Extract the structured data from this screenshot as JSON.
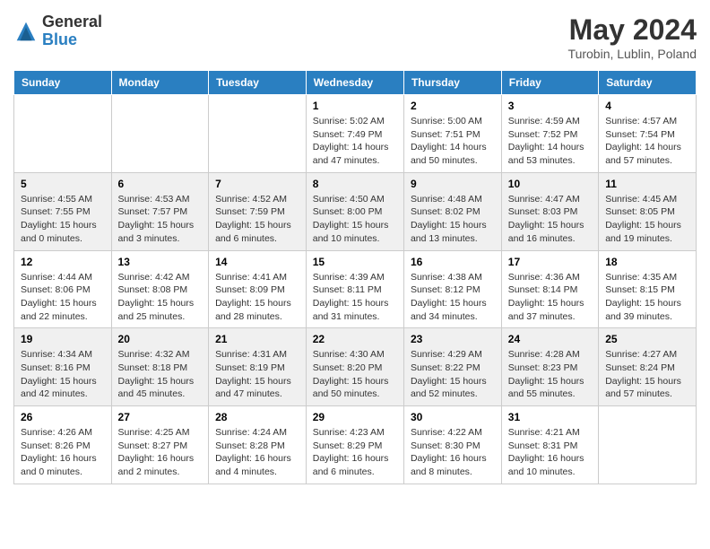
{
  "header": {
    "logo_general": "General",
    "logo_blue": "Blue",
    "month_title": "May 2024",
    "location": "Turobin, Lublin, Poland"
  },
  "columns": [
    "Sunday",
    "Monday",
    "Tuesday",
    "Wednesday",
    "Thursday",
    "Friday",
    "Saturday"
  ],
  "weeks": [
    [
      {
        "day": "",
        "info": ""
      },
      {
        "day": "",
        "info": ""
      },
      {
        "day": "",
        "info": ""
      },
      {
        "day": "1",
        "info": "Sunrise: 5:02 AM\nSunset: 7:49 PM\nDaylight: 14 hours\nand 47 minutes."
      },
      {
        "day": "2",
        "info": "Sunrise: 5:00 AM\nSunset: 7:51 PM\nDaylight: 14 hours\nand 50 minutes."
      },
      {
        "day": "3",
        "info": "Sunrise: 4:59 AM\nSunset: 7:52 PM\nDaylight: 14 hours\nand 53 minutes."
      },
      {
        "day": "4",
        "info": "Sunrise: 4:57 AM\nSunset: 7:54 PM\nDaylight: 14 hours\nand 57 minutes."
      }
    ],
    [
      {
        "day": "5",
        "info": "Sunrise: 4:55 AM\nSunset: 7:55 PM\nDaylight: 15 hours\nand 0 minutes."
      },
      {
        "day": "6",
        "info": "Sunrise: 4:53 AM\nSunset: 7:57 PM\nDaylight: 15 hours\nand 3 minutes."
      },
      {
        "day": "7",
        "info": "Sunrise: 4:52 AM\nSunset: 7:59 PM\nDaylight: 15 hours\nand 6 minutes."
      },
      {
        "day": "8",
        "info": "Sunrise: 4:50 AM\nSunset: 8:00 PM\nDaylight: 15 hours\nand 10 minutes."
      },
      {
        "day": "9",
        "info": "Sunrise: 4:48 AM\nSunset: 8:02 PM\nDaylight: 15 hours\nand 13 minutes."
      },
      {
        "day": "10",
        "info": "Sunrise: 4:47 AM\nSunset: 8:03 PM\nDaylight: 15 hours\nand 16 minutes."
      },
      {
        "day": "11",
        "info": "Sunrise: 4:45 AM\nSunset: 8:05 PM\nDaylight: 15 hours\nand 19 minutes."
      }
    ],
    [
      {
        "day": "12",
        "info": "Sunrise: 4:44 AM\nSunset: 8:06 PM\nDaylight: 15 hours\nand 22 minutes."
      },
      {
        "day": "13",
        "info": "Sunrise: 4:42 AM\nSunset: 8:08 PM\nDaylight: 15 hours\nand 25 minutes."
      },
      {
        "day": "14",
        "info": "Sunrise: 4:41 AM\nSunset: 8:09 PM\nDaylight: 15 hours\nand 28 minutes."
      },
      {
        "day": "15",
        "info": "Sunrise: 4:39 AM\nSunset: 8:11 PM\nDaylight: 15 hours\nand 31 minutes."
      },
      {
        "day": "16",
        "info": "Sunrise: 4:38 AM\nSunset: 8:12 PM\nDaylight: 15 hours\nand 34 minutes."
      },
      {
        "day": "17",
        "info": "Sunrise: 4:36 AM\nSunset: 8:14 PM\nDaylight: 15 hours\nand 37 minutes."
      },
      {
        "day": "18",
        "info": "Sunrise: 4:35 AM\nSunset: 8:15 PM\nDaylight: 15 hours\nand 39 minutes."
      }
    ],
    [
      {
        "day": "19",
        "info": "Sunrise: 4:34 AM\nSunset: 8:16 PM\nDaylight: 15 hours\nand 42 minutes."
      },
      {
        "day": "20",
        "info": "Sunrise: 4:32 AM\nSunset: 8:18 PM\nDaylight: 15 hours\nand 45 minutes."
      },
      {
        "day": "21",
        "info": "Sunrise: 4:31 AM\nSunset: 8:19 PM\nDaylight: 15 hours\nand 47 minutes."
      },
      {
        "day": "22",
        "info": "Sunrise: 4:30 AM\nSunset: 8:20 PM\nDaylight: 15 hours\nand 50 minutes."
      },
      {
        "day": "23",
        "info": "Sunrise: 4:29 AM\nSunset: 8:22 PM\nDaylight: 15 hours\nand 52 minutes."
      },
      {
        "day": "24",
        "info": "Sunrise: 4:28 AM\nSunset: 8:23 PM\nDaylight: 15 hours\nand 55 minutes."
      },
      {
        "day": "25",
        "info": "Sunrise: 4:27 AM\nSunset: 8:24 PM\nDaylight: 15 hours\nand 57 minutes."
      }
    ],
    [
      {
        "day": "26",
        "info": "Sunrise: 4:26 AM\nSunset: 8:26 PM\nDaylight: 16 hours\nand 0 minutes."
      },
      {
        "day": "27",
        "info": "Sunrise: 4:25 AM\nSunset: 8:27 PM\nDaylight: 16 hours\nand 2 minutes."
      },
      {
        "day": "28",
        "info": "Sunrise: 4:24 AM\nSunset: 8:28 PM\nDaylight: 16 hours\nand 4 minutes."
      },
      {
        "day": "29",
        "info": "Sunrise: 4:23 AM\nSunset: 8:29 PM\nDaylight: 16 hours\nand 6 minutes."
      },
      {
        "day": "30",
        "info": "Sunrise: 4:22 AM\nSunset: 8:30 PM\nDaylight: 16 hours\nand 8 minutes."
      },
      {
        "day": "31",
        "info": "Sunrise: 4:21 AM\nSunset: 8:31 PM\nDaylight: 16 hours\nand 10 minutes."
      },
      {
        "day": "",
        "info": ""
      }
    ]
  ]
}
